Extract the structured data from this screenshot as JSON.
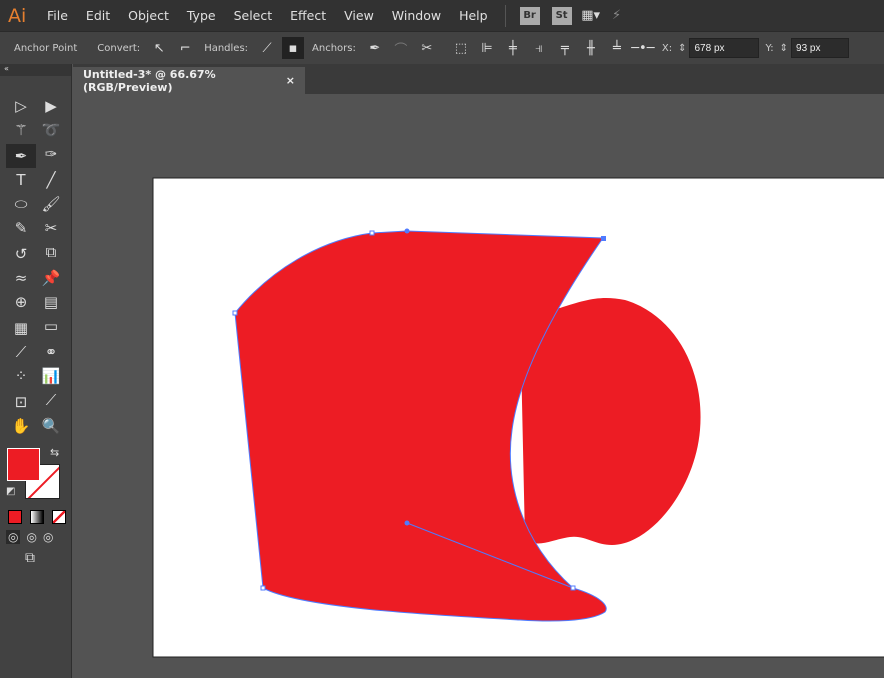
{
  "app": {
    "logo": "Ai",
    "menus": [
      "File",
      "Edit",
      "Object",
      "Type",
      "Select",
      "Effect",
      "View",
      "Window",
      "Help"
    ],
    "bridge": "Br",
    "stock": "St"
  },
  "control": {
    "mode": "Anchor Point",
    "convert": "Convert:",
    "handles": "Handles:",
    "anchors": "Anchors:",
    "x_label": "X:",
    "x_value": "678 px",
    "y_label": "Y:",
    "y_value": "93 px"
  },
  "document": {
    "tab_title": "Untitled-3* @ 66.67% (RGB/Preview)",
    "close": "×"
  },
  "colors": {
    "fill": "#ed1c24",
    "path": "#4f7bff",
    "artboard": "#ffffff"
  },
  "tools": [
    "selection",
    "direct-selection",
    "magic-wand",
    "lasso",
    "pen",
    "curvature",
    "type",
    "line",
    "ellipse",
    "paintbrush",
    "shaper",
    "scissors",
    "rotate",
    "scale",
    "warp",
    "puppet-warp",
    "shape-builder",
    "perspective-grid",
    "mesh",
    "gradient",
    "eyedropper",
    "blend",
    "symbol-sprayer",
    "column-graph",
    "artboard",
    "slice",
    "hand",
    "zoom"
  ]
}
